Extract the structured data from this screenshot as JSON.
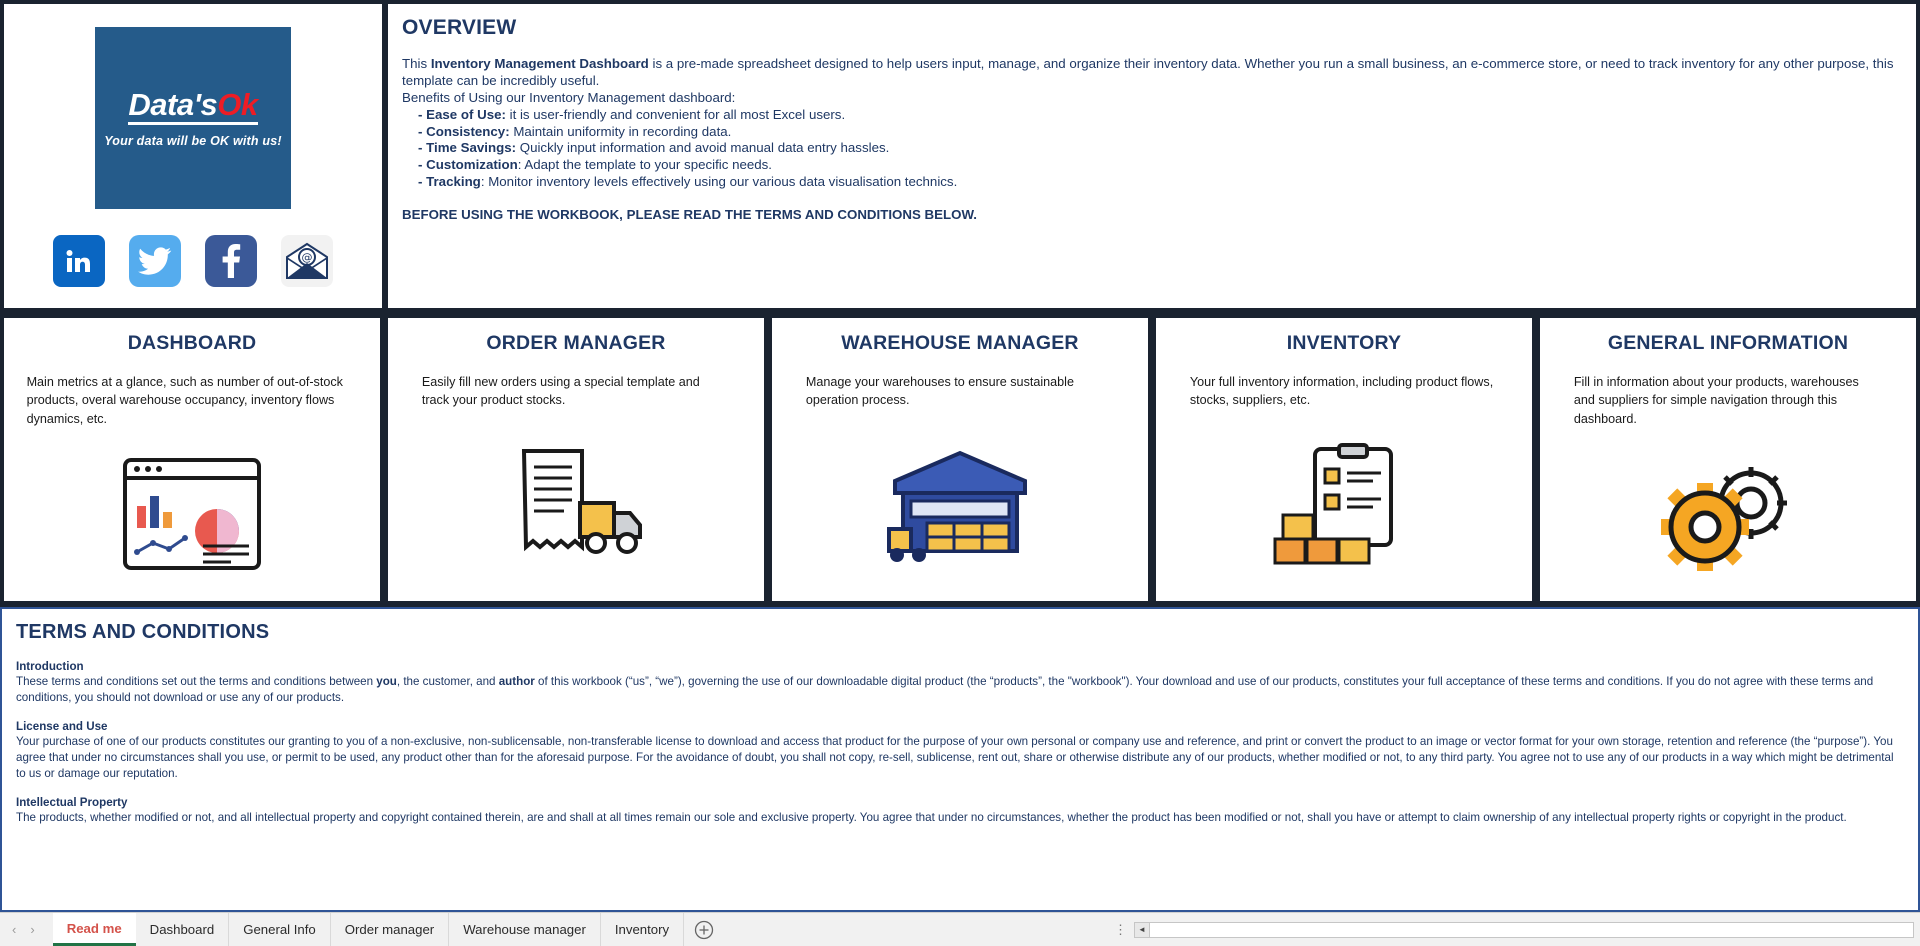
{
  "overview": {
    "title": "OVERVIEW",
    "intro_lead": "This ",
    "intro_bold": "Inventory Management Dashboard",
    "intro_rest": " is a pre-made spreadsheet designed to help users input, manage, and organize their inventory data. Whether you run a small business, an e-commerce store, or need to track inventory for any other purpose, this template can be incredibly useful.",
    "benefits_label": "Benefits of Using our Inventory Management dashboard:",
    "benefits": [
      {
        "term": "- Ease of Use:",
        "text": " it is user-friendly and convenient for all most Excel users."
      },
      {
        "term": "- Consistency:",
        "text": " Maintain uniformity in recording data."
      },
      {
        "term": "- Time Savings:",
        "text": " Quickly input information and avoid manual data entry hassles."
      },
      {
        "term": "- Customization",
        "text": ": Adapt the template to your specific needs."
      },
      {
        "term": "- Tracking",
        "text": ": Monitor inventory levels effectively using our various data visualisation technics."
      }
    ],
    "warning": "BEFORE USING THE WORKBOOK, PLEASE READ THE TERMS AND CONDITIONS BELOW."
  },
  "logo": {
    "brand_main": "Data's",
    "brand_accent": "Ok",
    "tagline": "Your data will be OK with us!",
    "brand_bg": "#255b8a",
    "accent_color": "#ee1c25",
    "socials": [
      {
        "name": "linkedin",
        "label": "in"
      },
      {
        "name": "twitter",
        "label": "Twitter"
      },
      {
        "name": "facebook",
        "label": "f"
      },
      {
        "name": "email",
        "label": "@"
      }
    ]
  },
  "cards": [
    {
      "title": "DASHBOARD",
      "desc": "Main metrics at a glance, such as number of out-of-stock products, overal warehouse occupancy, inventory flows dynamics, etc.",
      "icon": "dashboard-chart-icon"
    },
    {
      "title": "ORDER MANAGER",
      "desc": "Easily fill new orders using a special template and track your product stocks.",
      "icon": "invoice-truck-icon"
    },
    {
      "title": "WAREHOUSE MANAGER",
      "desc": "Manage your warehouses to ensure sustainable operation process.",
      "icon": "warehouse-icon"
    },
    {
      "title": "INVENTORY",
      "desc": "Your full inventory information, including product flows, stocks, suppliers, etc.",
      "icon": "clipboard-boxes-icon"
    },
    {
      "title": "GENERAL INFORMATION",
      "desc": "Fill in information about your products, warehouses and suppliers for simple navigation through this dashboard.",
      "icon": "gears-icon"
    }
  ],
  "terms": {
    "title": "TERMS AND CONDITIONS",
    "sections": [
      {
        "heading": "Introduction",
        "body_1": "These terms and conditions set out the terms and conditions between ",
        "b1": "you",
        "body_2": ", the customer, and ",
        "b2": "author",
        "body_3": " of this workbook (“us”, “we”), governing the use of our downloadable digital product (the “products”, the \"workbook\"). Your download and use of our products, constitutes your full acceptance of these terms and conditions. If you do not agree with these terms and conditions, you should not download or use any of our products."
      },
      {
        "heading": "License and Use",
        "body": "Your purchase of one of our products constitutes our granting to you of a non-exclusive, non-sublicensable, non-transferable license to download and access that product for the purpose of your own personal or company use and reference, and print or convert the product to an image or vector format for your own storage, retention and reference (the “purpose”). You agree that under no circumstances shall you use, or permit to be used, any product other than for the aforesaid purpose. For the avoidance of doubt, you shall not copy, re-sell, sublicense, rent out, share or otherwise distribute any of our products, whether modified or not, to any third party. You agree not to use any of our products in a way which might be detrimental to us or damage our reputation."
      },
      {
        "heading": "Intellectual Property",
        "body": "The products, whether modified or not, and all intellectual property and copyright contained therein, are and shall at all times remain our sole and exclusive property. You agree that under no circumstances, whether the product has been modified or not, shall you have or attempt to claim ownership of any intellectual property rights or copyright in the product."
      }
    ]
  },
  "sheet_tabs": {
    "tabs": [
      {
        "label": "Read me",
        "active": true
      },
      {
        "label": "Dashboard",
        "active": false
      },
      {
        "label": "General Info",
        "active": false
      },
      {
        "label": "Order manager",
        "active": false
      },
      {
        "label": "Warehouse manager",
        "active": false
      },
      {
        "label": "Inventory",
        "active": false
      }
    ],
    "add_label": "+",
    "prev_label": "‹",
    "next_label": "›",
    "dots_label": "⋮"
  }
}
